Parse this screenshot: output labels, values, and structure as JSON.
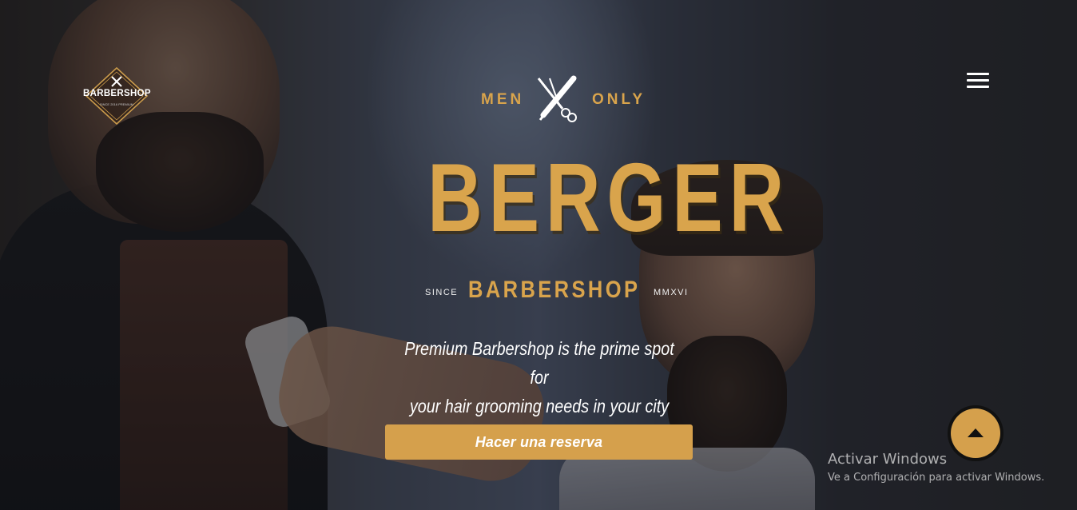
{
  "header": {
    "logo_text": "BARBERSHOP",
    "logo_subtext": "SINCE 2016 PREMIUM",
    "menu_icon": "hamburger-menu-icon"
  },
  "hero": {
    "tag_left": "MEN",
    "tag_right": "ONLY",
    "tools_icon": "razor-scissors-icon",
    "brand": "BERGER",
    "since": "SINCE",
    "subtitle": "BARBERSHOP",
    "year_roman": "MMXVI",
    "description_line1": "Premium Barbershop is the prime spot for",
    "description_line2": "your hair grooming needs in your city",
    "cta_label": "Hacer una reserva"
  },
  "scroll_top": {
    "icon": "arrow-up-icon"
  },
  "windows_watermark": {
    "title": "Activar Windows",
    "subtitle": "Ve a Configuración para activar Windows."
  },
  "colors": {
    "accent_gold": "#d5a04c",
    "text_white": "#ffffff",
    "dark": "#111111"
  }
}
